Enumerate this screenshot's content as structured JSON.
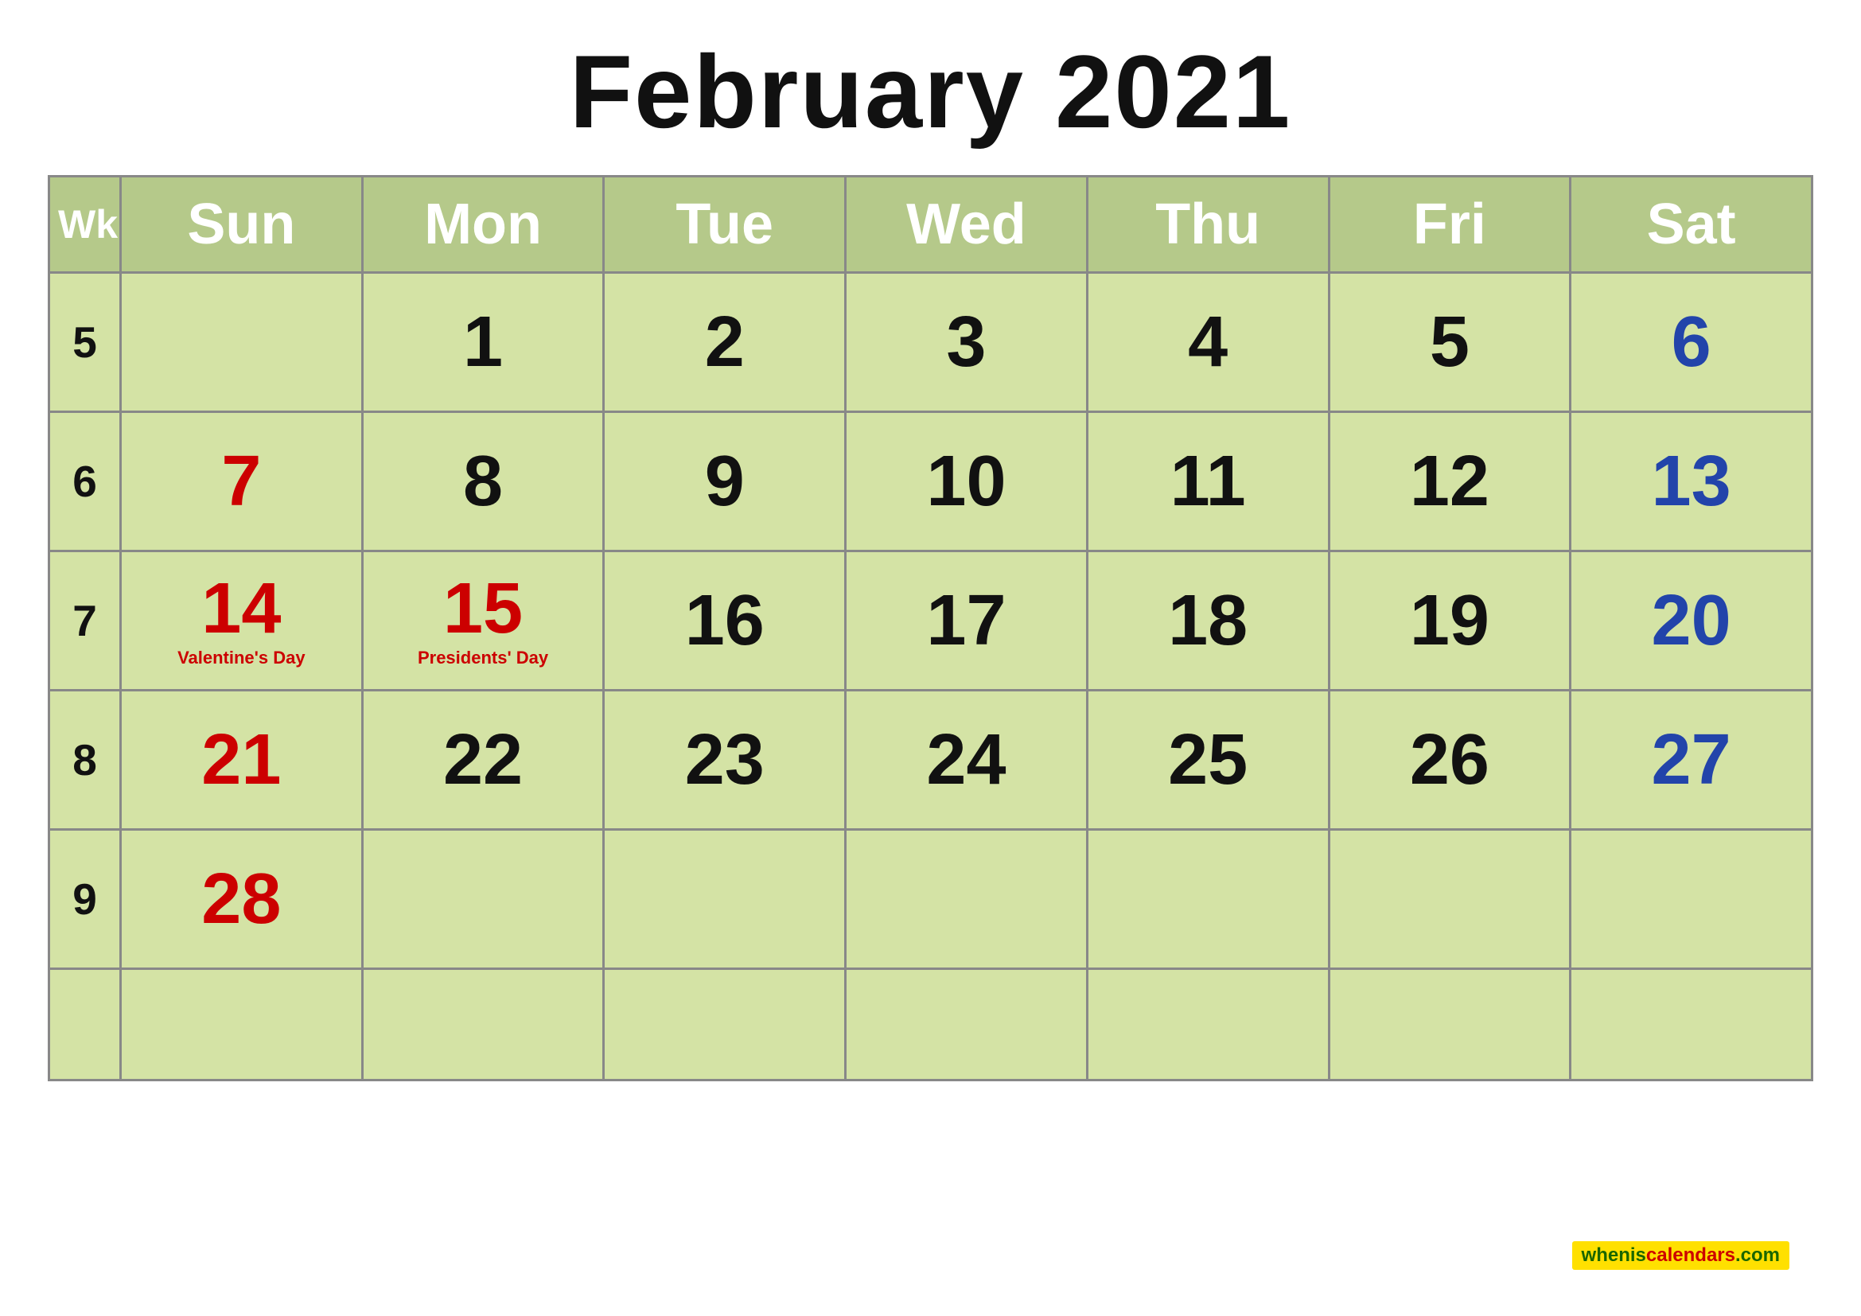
{
  "title": "February 2021",
  "header": {
    "wk": "Wk",
    "days": [
      "Sun",
      "Mon",
      "Tue",
      "Wed",
      "Thu",
      "Fri",
      "Sat"
    ]
  },
  "rows": [
    {
      "wk": "5",
      "cells": [
        {
          "day": "",
          "type": "empty"
        },
        {
          "day": "1",
          "type": "weekday"
        },
        {
          "day": "2",
          "type": "weekday"
        },
        {
          "day": "3",
          "type": "weekday"
        },
        {
          "day": "4",
          "type": "weekday"
        },
        {
          "day": "5",
          "type": "weekday"
        },
        {
          "day": "6",
          "type": "saturday"
        }
      ]
    },
    {
      "wk": "6",
      "cells": [
        {
          "day": "7",
          "type": "sunday"
        },
        {
          "day": "8",
          "type": "weekday"
        },
        {
          "day": "9",
          "type": "weekday"
        },
        {
          "day": "10",
          "type": "weekday"
        },
        {
          "day": "11",
          "type": "weekday"
        },
        {
          "day": "12",
          "type": "weekday"
        },
        {
          "day": "13",
          "type": "saturday"
        }
      ]
    },
    {
      "wk": "7",
      "cells": [
        {
          "day": "14",
          "type": "sunday",
          "holiday": "Valentine's Day"
        },
        {
          "day": "15",
          "type": "weekday-red",
          "holiday": "Presidents' Day"
        },
        {
          "day": "16",
          "type": "weekday"
        },
        {
          "day": "17",
          "type": "weekday"
        },
        {
          "day": "18",
          "type": "weekday"
        },
        {
          "day": "19",
          "type": "weekday"
        },
        {
          "day": "20",
          "type": "saturday"
        }
      ]
    },
    {
      "wk": "8",
      "cells": [
        {
          "day": "21",
          "type": "sunday"
        },
        {
          "day": "22",
          "type": "weekday"
        },
        {
          "day": "23",
          "type": "weekday"
        },
        {
          "day": "24",
          "type": "weekday"
        },
        {
          "day": "25",
          "type": "weekday"
        },
        {
          "day": "26",
          "type": "weekday"
        },
        {
          "day": "27",
          "type": "saturday"
        }
      ]
    },
    {
      "wk": "9",
      "cells": [
        {
          "day": "28",
          "type": "sunday"
        },
        {
          "day": "",
          "type": "empty"
        },
        {
          "day": "",
          "type": "empty"
        },
        {
          "day": "",
          "type": "empty"
        },
        {
          "day": "",
          "type": "empty"
        },
        {
          "day": "",
          "type": "empty"
        },
        {
          "day": "",
          "type": "empty"
        }
      ]
    }
  ],
  "extra_row": true,
  "watermark": {
    "text_black": "whenis",
    "text_red": "calendars",
    "text_black2": ".com"
  }
}
